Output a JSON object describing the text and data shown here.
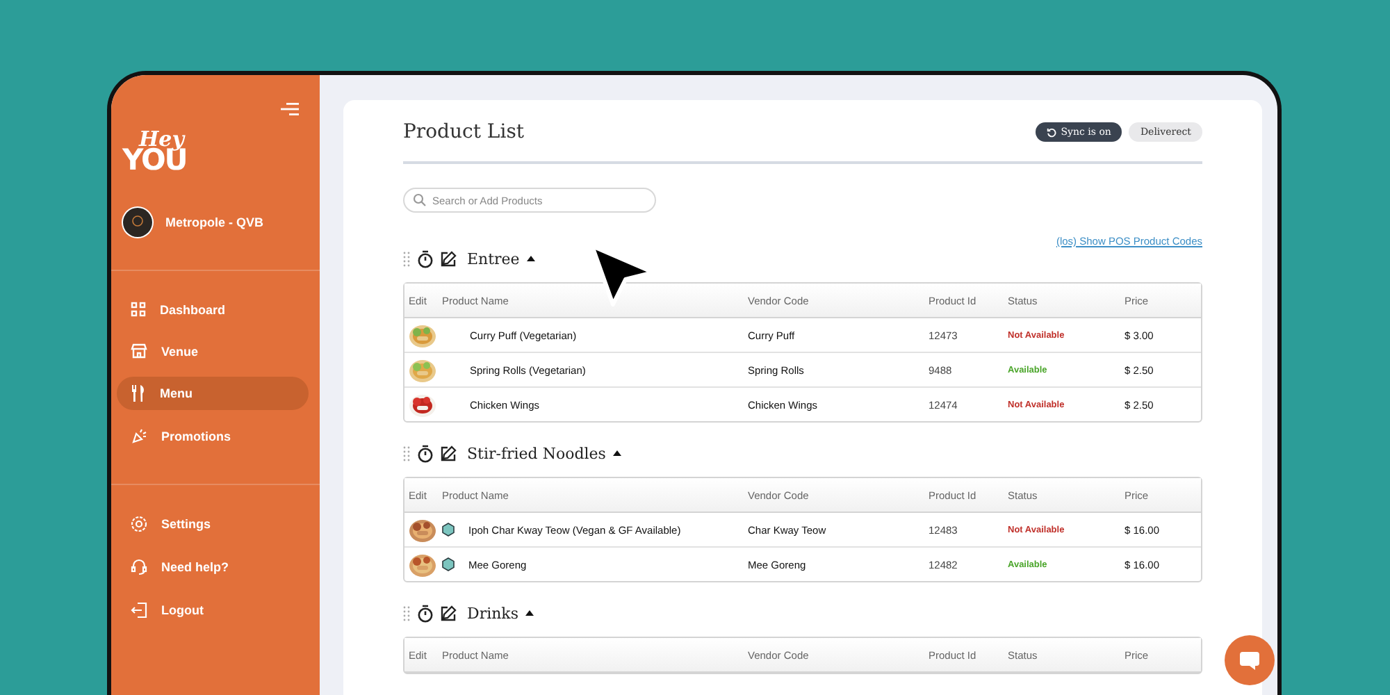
{
  "sidebar": {
    "brand": {
      "line_1": "Hey",
      "line_2": "YOU"
    },
    "venue": "Metropole - QVB",
    "nav": [
      {
        "label": "Dashboard",
        "selected": false
      },
      {
        "label": "Venue",
        "selected": false
      },
      {
        "label": "Menu",
        "selected": true
      },
      {
        "label": "Promotions",
        "selected": false
      }
    ],
    "footer_nav": [
      {
        "label": "Settings",
        "selected": false
      },
      {
        "label": "Need help?",
        "selected": false
      },
      {
        "label": "Logout",
        "selected": false
      }
    ]
  },
  "header": {
    "title": "Product List",
    "buttons": [
      {
        "label": "Sync is on",
        "kind": "sync"
      },
      {
        "label": "Deliverect",
        "kind": "plain"
      }
    ]
  },
  "search": {
    "placeholder": "Search or Add Products"
  },
  "pos_link": "(los) Show POS Product Codes",
  "sections": [
    {
      "name": "Entree",
      "expanded": true,
      "columns": [
        "Edit",
        "Product Name",
        "Vendor Code",
        "Product Id",
        "Status",
        "Price"
      ],
      "rows": [
        {
          "name": "Curry Puff (Vegetarian)",
          "marker": false,
          "vendor_code": "Curry Puff",
          "product_id": "12473",
          "status": "Not Available",
          "available": false,
          "price": "$ 3.00"
        },
        {
          "name": "Spring Rolls (Vegetarian)",
          "marker": false,
          "vendor_code": "Spring Rolls",
          "product_id": "9488",
          "status": "Available",
          "available": true,
          "price": "$ 2.50"
        },
        {
          "name": "Chicken Wings",
          "marker": false,
          "vendor_code": "Chicken Wings",
          "product_id": "12474",
          "status": "Not Available",
          "available": false,
          "price": "$ 2.50"
        }
      ]
    },
    {
      "name": "Stir-fried Noodles",
      "expanded": true,
      "columns": [
        "Edit",
        "Product Name",
        "Vendor Code",
        "Product Id",
        "Status",
        "Price"
      ],
      "rows": [
        {
          "name": "Ipoh Char Kway Teow (Vegan & GF Available)",
          "marker": true,
          "vendor_code": "Char Kway Teow",
          "product_id": "12483",
          "status": "Not Available",
          "available": false,
          "price": "$ 16.00"
        },
        {
          "name": "Mee Goreng",
          "marker": true,
          "vendor_code": "Mee Goreng",
          "product_id": "12482",
          "status": "Available",
          "available": true,
          "price": "$ 16.00"
        }
      ]
    },
    {
      "name": "Drinks",
      "expanded": true,
      "columns": [
        "Edit",
        "Product Name",
        "Vendor Code",
        "Product Id",
        "Status",
        "Price"
      ]
    }
  ]
}
